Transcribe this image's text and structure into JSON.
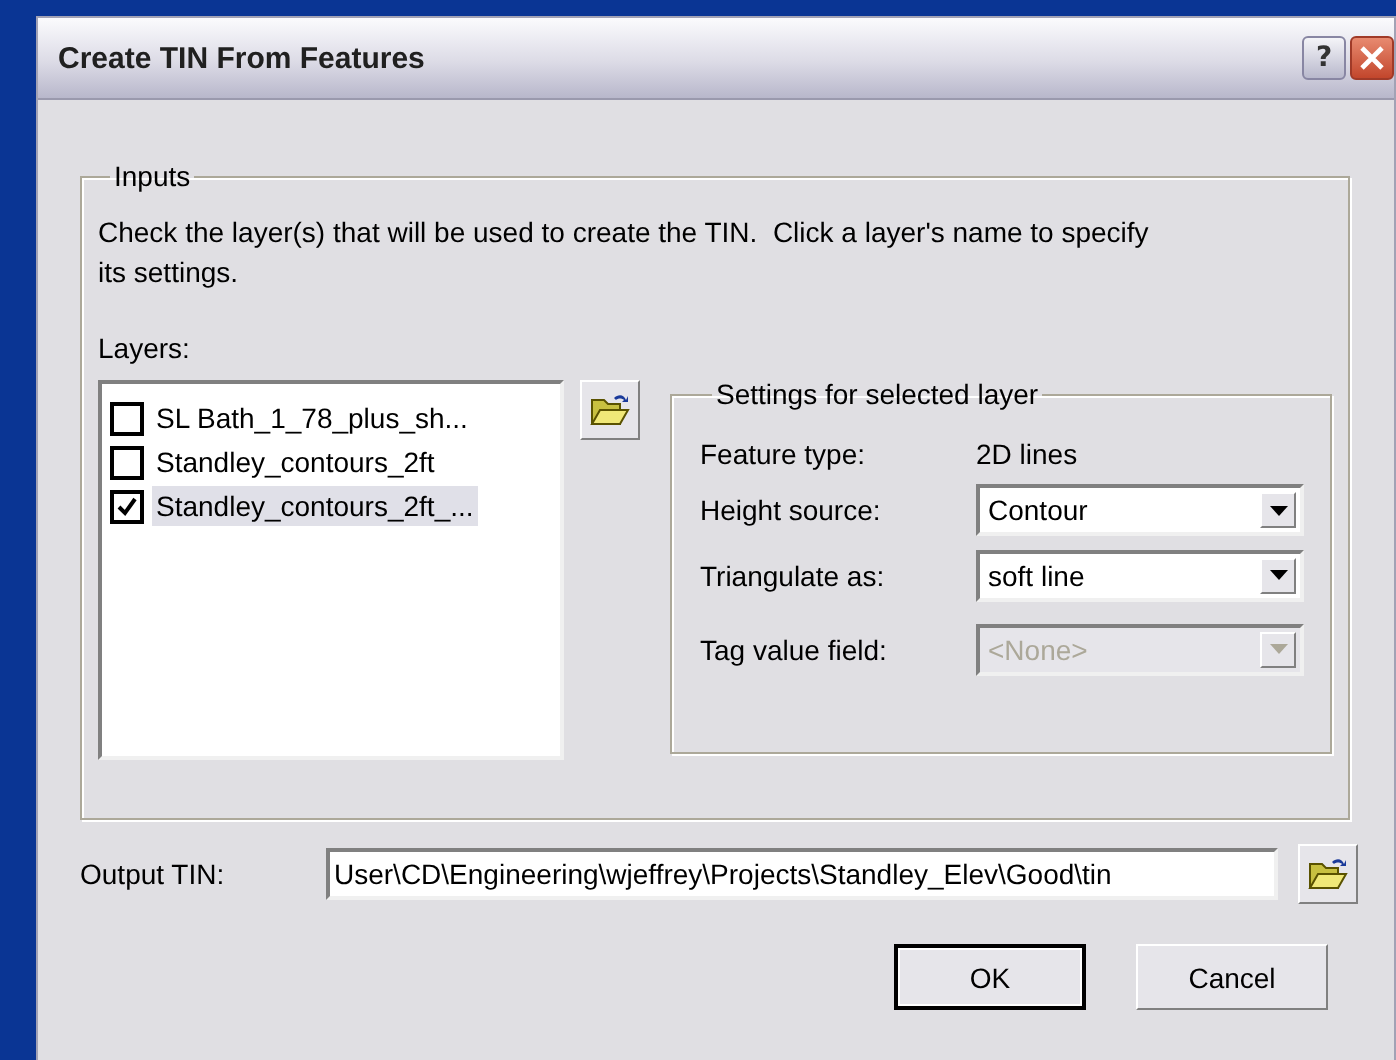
{
  "window": {
    "title": "Create TIN From Features"
  },
  "title_buttons": [
    {
      "kind": "help",
      "label": "?"
    },
    {
      "kind": "close"
    }
  ],
  "inputs": {
    "legend": "Inputs",
    "instructions": "Check the layer(s) that will be used to create the TIN.  Click a layer's name to specify its settings.",
    "layers_label": "Layers:",
    "layers": [
      {
        "name": "SL Bath_1_78_plus_sh...",
        "checked": false,
        "selected": false
      },
      {
        "name": "Standley_contours_2ft",
        "checked": false,
        "selected": false
      },
      {
        "name": "Standley_contours_2ft_...",
        "checked": true,
        "selected": true
      }
    ],
    "settings": {
      "legend": "Settings for selected layer",
      "feature_type_label": "Feature type:",
      "feature_type": "2D lines",
      "fields": [
        {
          "label": "Height source:",
          "value": "Contour",
          "disabled": false
        },
        {
          "label": "Triangulate as:",
          "value": "soft line",
          "disabled": false
        },
        {
          "label": "Tag value field:",
          "value": "<None>",
          "disabled": true
        }
      ]
    }
  },
  "output": {
    "label": "Output TIN:",
    "value": "User\\CD\\Engineering\\wjeffrey\\Projects\\Standley_Elev\\Good\\tin"
  },
  "buttons": [
    {
      "label": "OK",
      "default": true
    },
    {
      "label": "Cancel",
      "default": false
    }
  ]
}
